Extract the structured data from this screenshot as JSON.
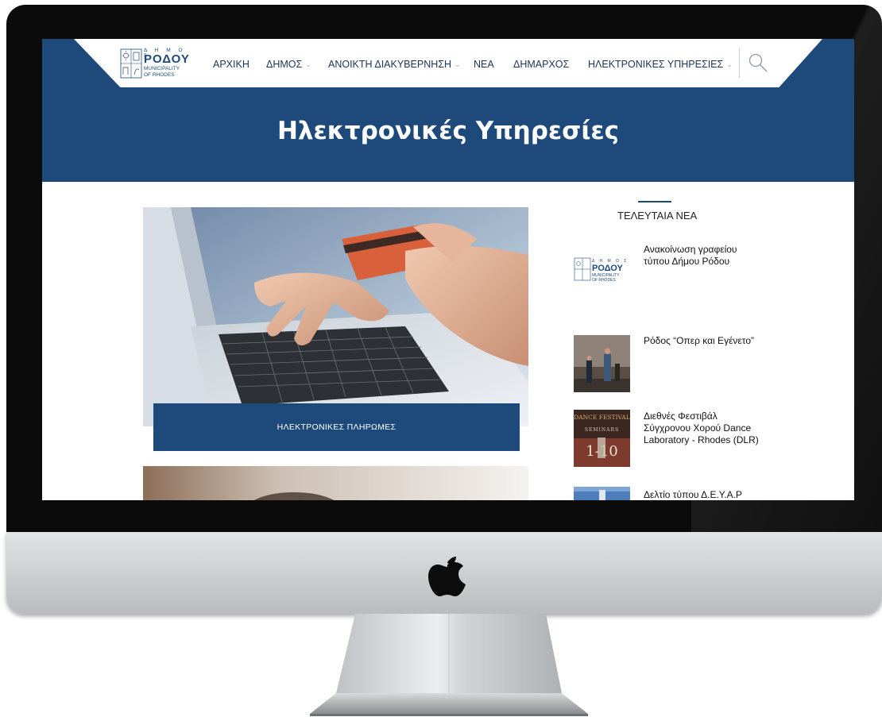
{
  "logo": {
    "small": "Δ Η Μ Ο Σ",
    "big": "ΡΟΔΟΥ",
    "municipality_line1": "MUNICIPALITY",
    "municipality_line2": "OF RHODES"
  },
  "nav": {
    "items": [
      {
        "label": "ΑΡΧΙΚΗ",
        "dropdown": false
      },
      {
        "label": "ΔΗΜΟΣ",
        "dropdown": true
      },
      {
        "label": "ΑΝΟΙΚΤΗ ΔΙΑΚΥΒΕΡΝΗΣΗ",
        "dropdown": true
      },
      {
        "label": "ΝΕΑ",
        "dropdown": false
      },
      {
        "label": "ΔΗΜΑΡΧΟΣ",
        "dropdown": false
      },
      {
        "label": "ΗΛΕΚΤΡΟΝΙΚΕΣ ΥΠΗΡΕΣΙΕΣ",
        "dropdown": true
      }
    ],
    "caret": "⌄",
    "search_icon": "search-icon"
  },
  "page": {
    "title": "Ηλεκτρονικές Υπηρεσίες"
  },
  "services": [
    {
      "label": "ΗΛΕΚΤΡΟΝΙΚΕΣ ΠΛΗΡΩΜΕΣ"
    }
  ],
  "sidebar": {
    "title": "ΤΕΛΕΥΤΑΙΑ ΝΕΑ",
    "news": [
      {
        "title": "Ανακοίνωση γραφείου τύπου Δήμου Ρόδου"
      },
      {
        "title": "Ρόδος “Οπερ και Εγένετο”"
      },
      {
        "title": "Διεθνές Φεστιβάλ Σύγχρονου Χορού Dance Laboratory - Rhodes (DLR)"
      },
      {
        "title": "Δελτίο τύπου Δ.Ε.Υ.Α.Ρ"
      }
    ],
    "thumb_logo_small": "Δ Η Μ Ο Σ",
    "thumb_logo_big": "ΡΟΔΟΥ",
    "thumb_logo_muni1": "MUNICIPALITY",
    "thumb_logo_muni2": "OF RHODES",
    "poster_text_1": "DANCE FESTIVAL",
    "poster_text_2": "SEMINARS",
    "poster_text_3": "1-10"
  },
  "colors": {
    "brand_blue": "#1d4a7b",
    "bezel": "#0b0b0b",
    "chin": "#c9cbcd"
  }
}
